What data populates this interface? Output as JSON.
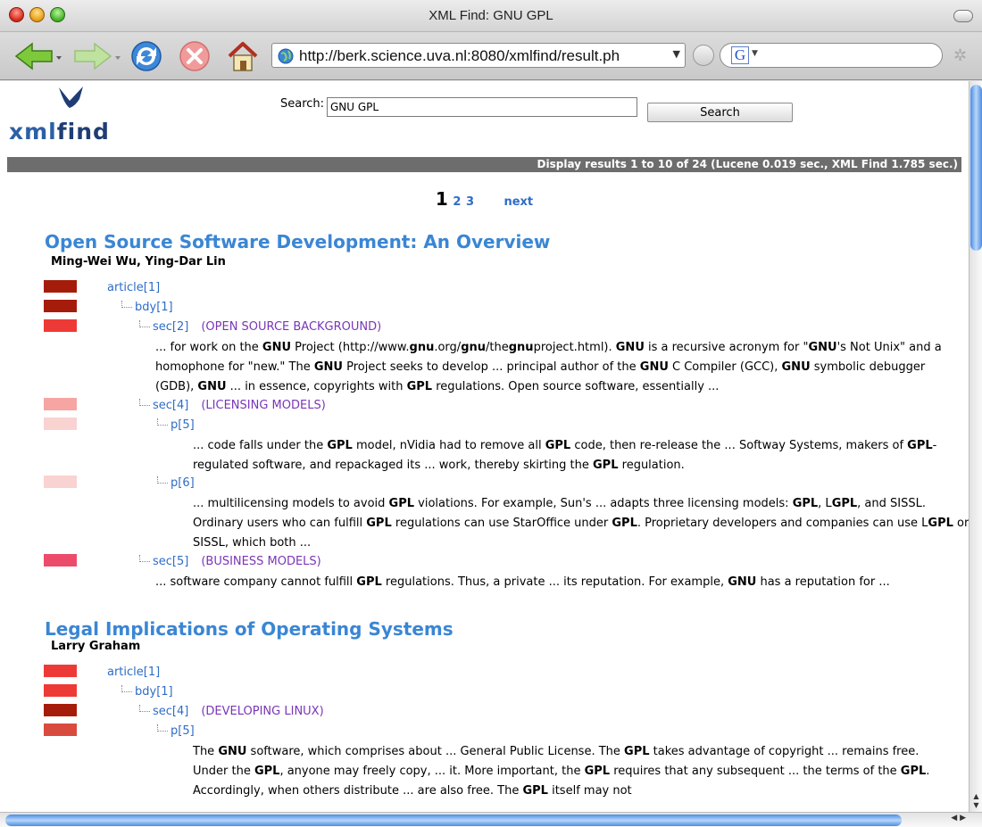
{
  "window": {
    "title": "XML Find: GNU GPL"
  },
  "toolbar": {
    "url": "http://berk.science.uva.nl:8080/xmlfind/result.ph",
    "google_label": "G"
  },
  "page": {
    "logo": {
      "part1": "xml",
      "part2": "find"
    },
    "search": {
      "label": "Search:",
      "value": "GNU GPL",
      "button": "Search"
    },
    "info": "Display results 1 to 10 of 24 (Lucene 0.019 sec., XML Find 1.785 sec.)",
    "pagination": {
      "current": "1",
      "pages": [
        "2",
        "3"
      ],
      "next": "next"
    },
    "results": [
      {
        "title": "Open Source Software Development: An Overview",
        "authors": "Ming-Wei Wu,  Ying-Dar Lin",
        "bar_colors": [
          "#a51d0a",
          "#a51d0a",
          "#ee3a36",
          "#f6a5a3",
          "#f9d3d1",
          "#f9d3d1",
          "#ec4c6a"
        ],
        "nodes": [
          {
            "label": "article[1]",
            "section": ""
          },
          {
            "label": "bdy[1]",
            "section": ""
          },
          {
            "label": "sec[2]",
            "section": "(OPEN SOURCE BACKGROUND)"
          },
          {
            "label": "sec[4]",
            "section": "(LICENSING MODELS)"
          },
          {
            "label": "p[5]",
            "section": ""
          },
          {
            "label": "p[6]",
            "section": ""
          },
          {
            "label": "sec[5]",
            "section": "(BUSINESS MODELS)"
          }
        ],
        "snippets": [
          "... for work on the <b>GNU</b> Project (http://www.<b>gnu</b>.org/<b>gnu</b>/the<b>gnu</b>project.html). <b>GNU</b> is a recursive acronym for \"<b>GNU</b>'s Not Unix\" and a homophone for \"new.\" The <b>GNU</b> Project seeks to develop ... principal author of the <b>GNU</b> C Compiler (GCC), <b>GNU</b> symbolic debugger (GDB), <b>GNU</b> ... in essence, copyrights with <b>GPL</b> regulations. Open source software, essentially ...",
          "... code falls under the <b>GPL</b> model, nVidia had to remove all <b>GPL</b> code, then re-release the ... Softway Systems, makers of <b>GPL</b>-regulated software, and repackaged its ... work, thereby skirting the <b>GPL</b> regulation.",
          "... multilicensing models to avoid <b>GPL</b> violations. For example, Sun's ... adapts three licensing models: <b>GPL</b>, L<b>GPL</b>, and SISSL. Ordinary users who can fulfill <b>GPL</b> regulations can use StarOffice under <b>GPL</b>. Proprietary developers and companies can use L<b>GPL</b> or SISSL, which both ...",
          "... software company cannot fulfill <b>GPL</b> regulations. Thus, a private ... its reputation. For example, <b>GNU</b> has a reputation for ..."
        ]
      },
      {
        "title": "Legal Implications of Operating Systems",
        "authors": "Larry Graham",
        "bar_colors": [
          "#ee3a36",
          "#ee3a36",
          "#a51d0a",
          "#d94b3f"
        ],
        "nodes": [
          {
            "label": "article[1]",
            "section": ""
          },
          {
            "label": "bdy[1]",
            "section": ""
          },
          {
            "label": "sec[4]",
            "section": "(DEVELOPING LINUX)"
          },
          {
            "label": "p[5]",
            "section": ""
          }
        ],
        "snippets": [
          "The <b>GNU</b> software, which comprises about ... General Public License. The <b>GPL</b> takes advantage of copyright ... remains free. Under the <b>GPL</b>, anyone may freely copy, ... it. More important, the <b>GPL</b> requires that any subsequent ... the terms of the <b>GPL</b>. Accordingly, when others distribute ... are also free. The <b>GPL</b> itself may not"
        ]
      }
    ]
  }
}
